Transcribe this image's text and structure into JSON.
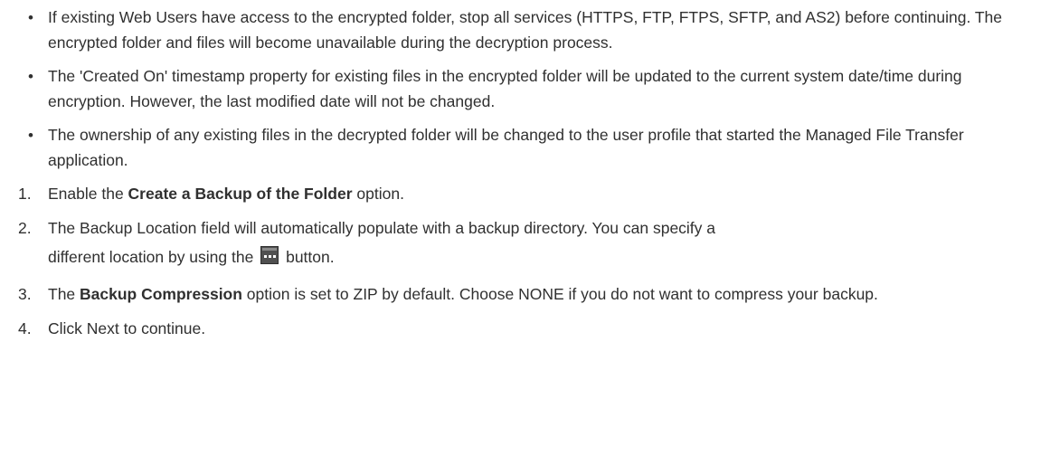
{
  "bullets": [
    "If existing Web Users have access to the encrypted folder, stop all services (HTTPS, FTP, FTPS, SFTP, and AS2) before continuing. The encrypted folder and files will become unavailable during the decryption process.",
    "The 'Created On' timestamp property for existing files in the encrypted folder will be updated to the current system date/time during encryption. However, the last modified date will not be changed.",
    "The ownership of any existing files in the decrypted folder will be changed to the user profile that started the Managed File Transfer application."
  ],
  "bullet_symbol": "•",
  "steps": [
    {
      "number": "1.",
      "prefix": "Enable the ",
      "bold": "Create a Backup of the Folder",
      "suffix": " option."
    },
    {
      "number": "2.",
      "line1": "The Backup Location field will automatically populate with a backup directory. You can specify a",
      "line2_prefix": "different location by using the",
      "line2_suffix": "button.",
      "button_icon": "ellipsis-browse-icon"
    },
    {
      "number": "3.",
      "prefix": "The ",
      "bold": "Backup Compression",
      "suffix": " option is set to ZIP by default. Choose NONE if you do not want to compress your backup."
    },
    {
      "number": "4.",
      "text": "Click Next to continue."
    }
  ],
  "colors": {
    "text": "#303030",
    "button_bg": "#505050"
  }
}
